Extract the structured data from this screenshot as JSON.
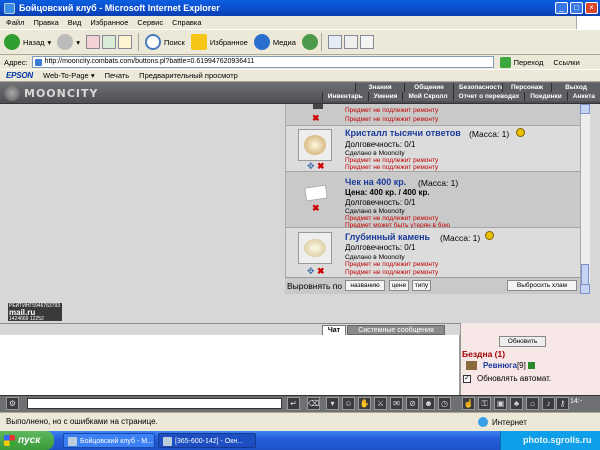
{
  "window": {
    "title": "Бойцовский клуб - Microsoft Internet Explorer",
    "min": "_",
    "max": "□",
    "close": "×"
  },
  "menu": [
    "Файл",
    "Правка",
    "Вид",
    "Избранное",
    "Сервис",
    "Справка"
  ],
  "toolbar": {
    "back": "Назад",
    "search": "Поиск",
    "favorites": "Избранное",
    "media": "Медиа"
  },
  "address": {
    "label": "Адрес:",
    "url": "http://mooncity.combats.com/buttons.pl?battle=0.619947620936411",
    "go": "Переход",
    "links": "Ссылки"
  },
  "epson": {
    "brand": "EPSON",
    "web_to_page": "Web-To-Page ▾",
    "print": "Печать",
    "preview": "Предварительный просмотр"
  },
  "site": {
    "logo": "MOONCITY",
    "nav_top": [
      "Знания",
      "Общение",
      "Безопасность",
      "Персонаж",
      "Выход"
    ],
    "nav_bottom": [
      "Инвентарь",
      "Умения",
      "Мой Скролл",
      "Отчет о переводах",
      "Поединки",
      "Анкета"
    ]
  },
  "counter": {
    "line1": "РЕЙТИНГ5946763793",
    "brand": "mail.ru",
    "line2": "1424669",
    "line3": "12252"
  },
  "inventory": {
    "items": [
      {
        "red1": "Предмет не подлежит ремонту",
        "red2": "Предмет не подлежит ремонту"
      },
      {
        "name": "Кристалл тысячи ответов",
        "mass": "(Масса: 1)",
        "durability": "Долговечность: 0/1",
        "made": "Сделано в Mooncity",
        "red1": "Предмет не подлежит ремонту",
        "red2": "Предмет не подлежит ремонту"
      },
      {
        "name": "Чек на 400 кр.",
        "mass": "(Масса: 1)",
        "price": "Цена: 400 кр. / 400 кр.",
        "durability": "Долговечность: 0/1",
        "made": "Сделано в Mooncity",
        "red1": "Предмет не подлежит ремонту",
        "red2": "Предмет может быть утерян в бою"
      },
      {
        "name": "Глубинный камень",
        "mass": "(Масса: 1)",
        "durability": "Долговечность: 0/1",
        "made": "Сделано в Mooncity",
        "red1": "Предмет не подлежит ремонту",
        "red2": "Предмет не подлежит ремонту"
      }
    ],
    "sort_label": "Выровнять по",
    "sort_name": "названию",
    "sort_price": "цене",
    "sort_type": "типу",
    "discard": "Выбросить хлам"
  },
  "chat": {
    "tab_chat": "Чат",
    "tab_system": "Системные сообщения"
  },
  "side": {
    "refresh": "Обновить",
    "room": "Бездна (1)",
    "user": "Ревнюга",
    "level": "[9]",
    "auto": "Обновлять автомат."
  },
  "inputbar": {
    "clock": "14:-"
  },
  "status": {
    "text": "Выполнено, но с ошибками на странице.",
    "zone": "Интернет"
  },
  "taskbar": {
    "start": "пуск",
    "task1": "Бойцовский клуб - M...",
    "task2": "[365-600-142] - Окн...",
    "watermark": "photo.sgrolls.ru"
  }
}
